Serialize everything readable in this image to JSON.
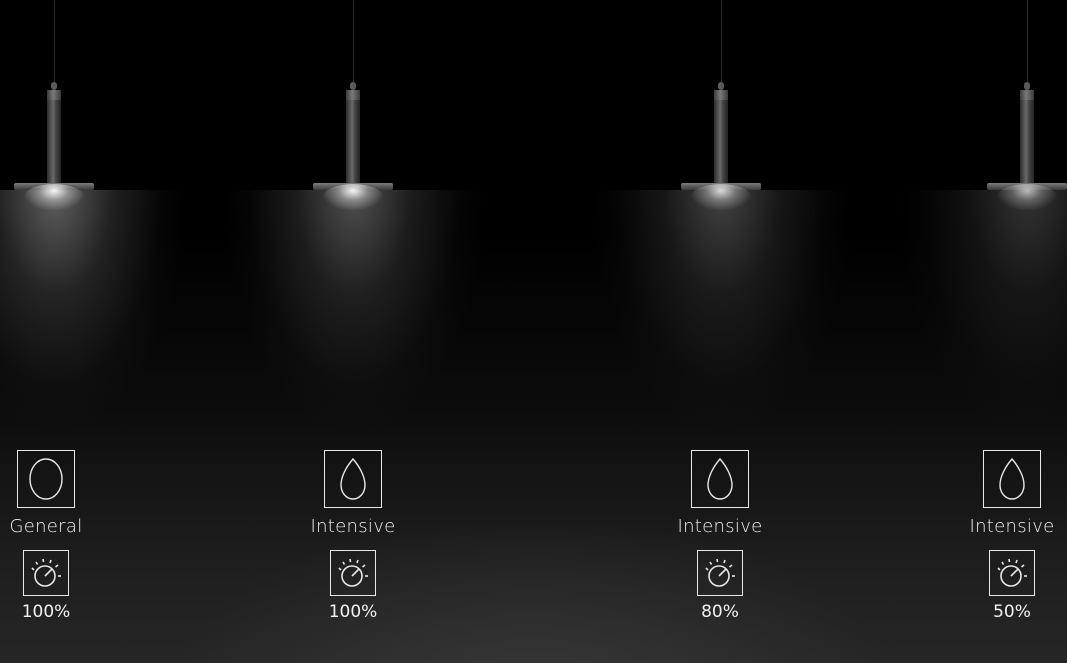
{
  "lights": [
    {
      "distribution": "General",
      "intensity": "100%",
      "beam_shape": "oval-icon",
      "dimmer_icon": "dimmer-dial-icon"
    },
    {
      "distribution": "Intensive",
      "intensity": "100%",
      "beam_shape": "teardrop-icon",
      "dimmer_icon": "dimmer-dial-icon"
    },
    {
      "distribution": "Intensive",
      "intensity": "80%",
      "beam_shape": "teardrop-icon",
      "dimmer_icon": "dimmer-dial-icon"
    },
    {
      "distribution": "Intensive",
      "intensity": "50%",
      "beam_shape": "teardrop-icon",
      "dimmer_icon": "dimmer-dial-icon"
    }
  ],
  "colors": {
    "background": "#000000",
    "text": "#f2f2f2",
    "icon_stroke": "#e8e8e8"
  }
}
